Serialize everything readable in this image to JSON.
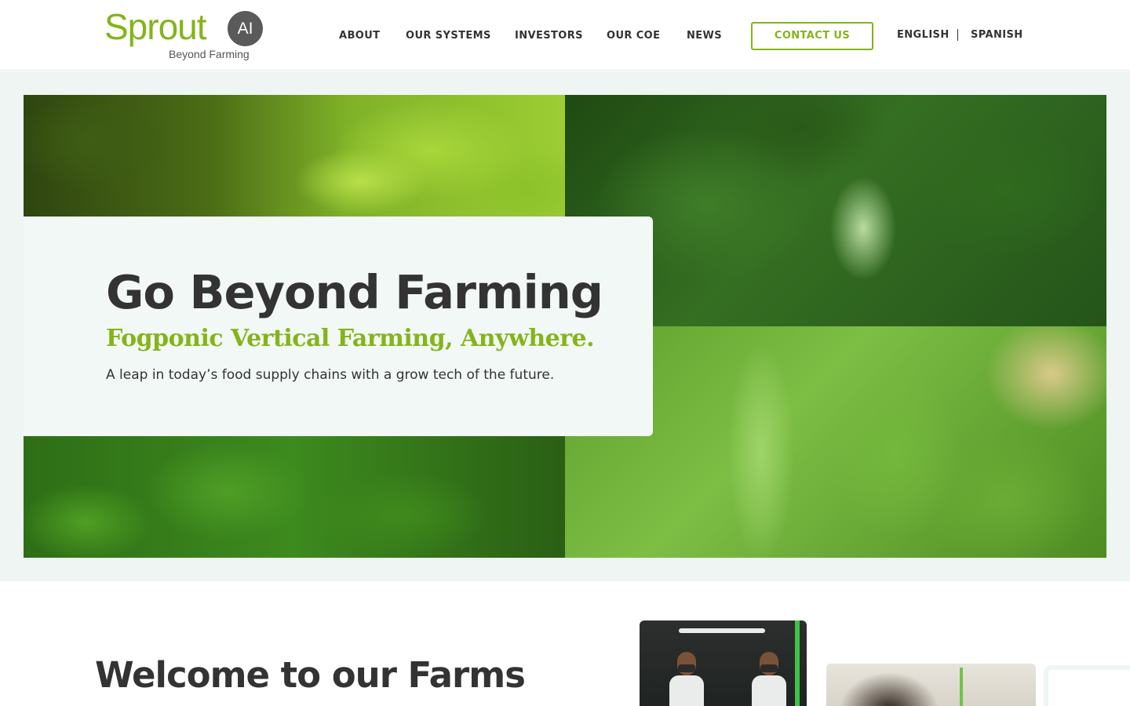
{
  "header": {
    "logo": {
      "wordmark": "Sprout",
      "badge": "AI",
      "tagline": "Beyond Farming"
    },
    "nav": [
      {
        "label": "ABOUT"
      },
      {
        "label": "OUR SYSTEMS"
      },
      {
        "label": "INVESTORS"
      },
      {
        "label": "OUR COE"
      },
      {
        "label": "NEWS"
      }
    ],
    "contact_label": "CONTACT US",
    "languages": [
      "ENGLISH",
      "SPANISH"
    ]
  },
  "hero": {
    "title": "Go Beyond Farming",
    "subtitle": "Fogponic Vertical Farming, Anywhere.",
    "description": "A leap in today’s food supply chains with a grow tech of the future."
  },
  "welcome": {
    "title": "Welcome to our Farms"
  },
  "colors": {
    "brand_green": "#84b41a",
    "text_dark": "#333333",
    "hero_bg": "#eef5f2",
    "logo_badge": "#5a5a5a"
  }
}
